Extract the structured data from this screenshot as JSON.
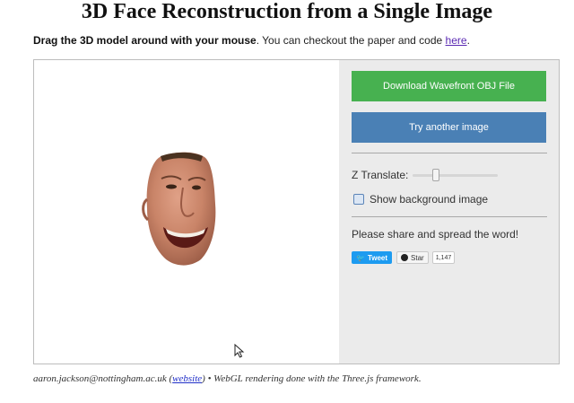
{
  "page": {
    "title": "3D Face Reconstruction from a Single Image",
    "intro_bold": "Drag the 3D model around with your mouse",
    "intro_text": ". You can checkout the paper and code ",
    "intro_link": "here",
    "intro_end": "."
  },
  "panel": {
    "download_button": "Download Wavefront OBJ File",
    "try_button": "Try another image",
    "z_label": "Z Translate:",
    "z_value": 0.25,
    "checkbox_label": "Show background image",
    "checkbox_checked": false,
    "share_text": "Please share and spread the word!",
    "tweet_label": "Tweet",
    "star_label": "Star",
    "star_count": "1,147"
  },
  "footer": {
    "email": "aaron.jackson@nottingham.ac.uk",
    "open_paren": " (",
    "website_link": "website",
    "rest": ") • WebGL rendering done with the Three.js framework."
  },
  "colors": {
    "download": "#47b150",
    "try": "#4a80b5",
    "panel_bg": "#ebebeb"
  }
}
